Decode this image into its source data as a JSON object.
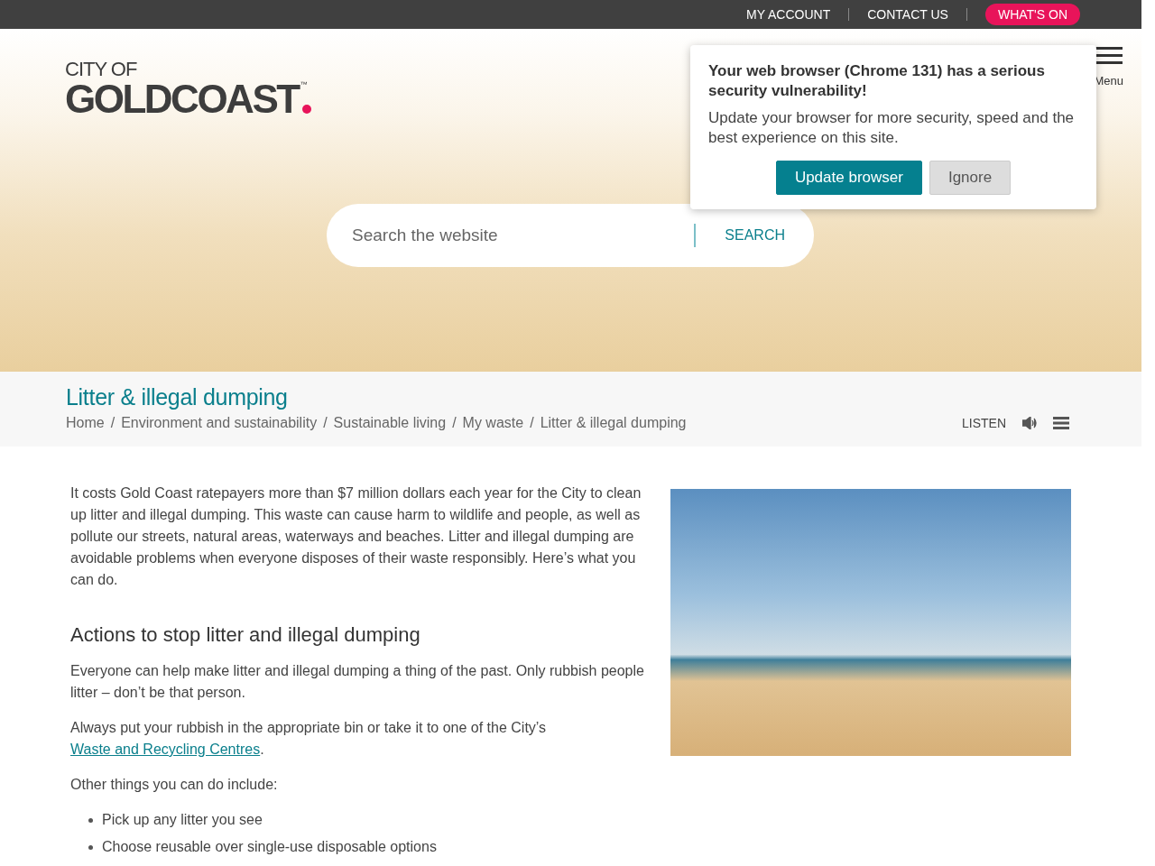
{
  "top_nav": {
    "links": [
      {
        "label": "MY ACCOUNT",
        "kind": "link"
      },
      {
        "label": "CONTACT US",
        "kind": "link"
      },
      {
        "label": "WHAT'S ON",
        "kind": "highlight"
      }
    ]
  },
  "header": {
    "logo": {
      "line_1": "CITY OF",
      "line_2": "GOLDCOAST",
      "mark": "™"
    },
    "menu_label": "Menu",
    "search": {
      "placeholder": "Search the website",
      "button": "SEARCH"
    }
  },
  "alert": {
    "title": "Your web browser (Chrome 131) has a serious security vulnerability!",
    "message": "Update your browser for more security, speed and the best experience on this site.",
    "buttons": [
      {
        "label": "Update browser",
        "kind": "primary"
      },
      {
        "label": "Ignore",
        "kind": "secondary"
      }
    ]
  },
  "page_header": {
    "title": "Litter & illegal dumping",
    "breadcrumbs": [
      "Home",
      "Environment and sustainability",
      "Sustainable living",
      "My waste",
      "Litter & illegal dumping"
    ],
    "separator": "/",
    "listen": "LISTEN"
  },
  "content": {
    "intro": "It costs Gold Coast ratepayers more than $7 million dollars each year for the City to clean up litter and illegal dumping. This waste can cause harm to wildlife and people, as well as pollute our streets, natural areas, waterways and beaches. Litter and illegal dumping are avoidable problems when everyone disposes of their waste responsibly. Here’s what you can do.",
    "heading": "Actions to stop litter and illegal dumping",
    "paragraph_1": "Everyone can help make litter and illegal dumping a thing of the past. Only rubbish people litter – don’t be that person.",
    "paragraph_2": {
      "text_before": "Always put your rubbish in the appropriate bin or take it to one of the City’s ",
      "link": "Waste and Recycling Centres",
      "text_after": "."
    },
    "paragraph_3": "Other things you can do include:",
    "bullets": [
      "Pick up any litter you see",
      "Choose reusable over single-use disposable options"
    ]
  }
}
